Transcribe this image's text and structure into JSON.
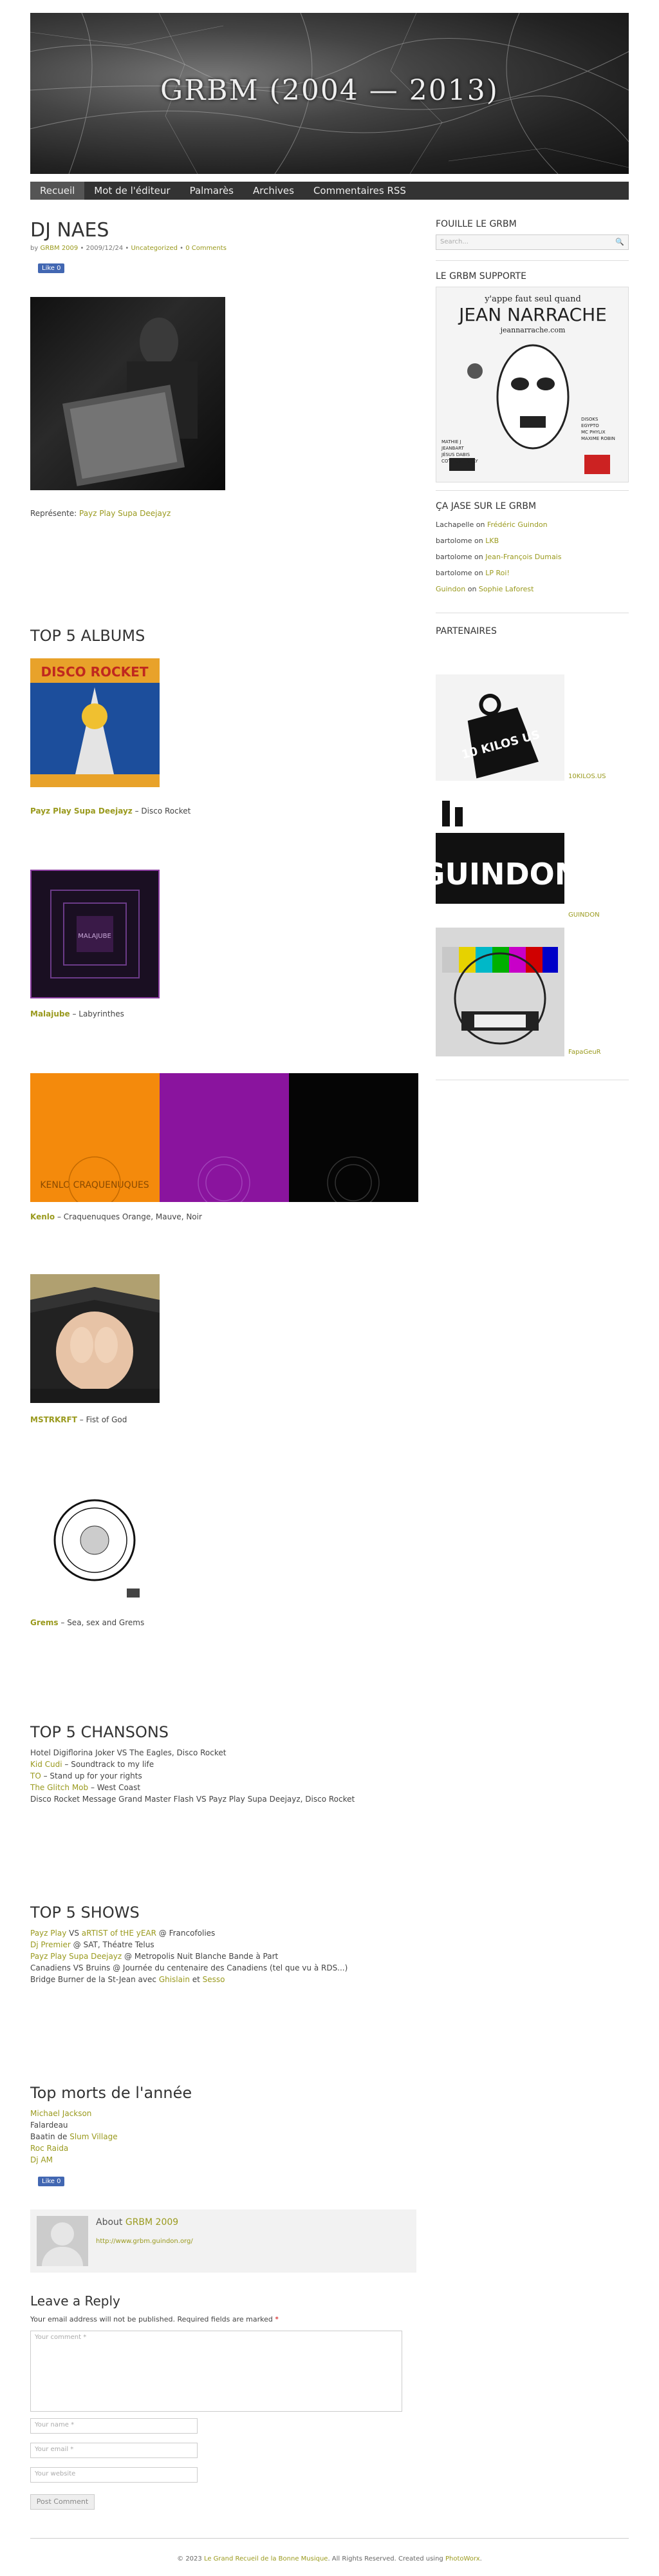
{
  "site": {
    "title": "GRBM (2004 — 2013)"
  },
  "nav": {
    "items": [
      "Recueil",
      "Mot de l'éditeur",
      "Palmarès",
      "Archives",
      "Commentaires RSS"
    ]
  },
  "post": {
    "title": "DJ NAES",
    "meta_by": "by",
    "meta_author": "GRBM 2009",
    "meta_date": " • 2009/12/24 • ",
    "meta_cat": "Uncategorized",
    "meta_sep": " • ",
    "meta_comments": "0 Comments",
    "like": "Like 0",
    "represent_label": "Représente: ",
    "represent_link": "Payz Play Supa Deejayz"
  },
  "albums": {
    "heading": "TOP 5 ALBUMS",
    "items": [
      {
        "artist": "Payz Play Supa Deejayz",
        "title": " – Disco Rocket"
      },
      {
        "artist": "Malajube",
        "title": " – Labyrinthes"
      },
      {
        "artist": "Kenlo",
        "title": " – Craquenuques Orange, Mauve, Noir"
      },
      {
        "artist": "MSTRKRFT",
        "title": " – Fist of God"
      },
      {
        "artist": "Grems",
        "title": " – Sea, sex and Grems"
      }
    ]
  },
  "songs": {
    "heading": "TOP 5 CHANSONS",
    "lines": [
      {
        "link": "",
        "text": "Hotel Digiflorina Joker VS The Eagles, Disco Rocket"
      },
      {
        "link": "Kid Cudi",
        "text": " – Soundtrack to my life"
      },
      {
        "link": "TO",
        "text": " – Stand up for your rights"
      },
      {
        "link": "The Glitch Mob",
        "text": " – West Coast"
      },
      {
        "link": "",
        "text": "Disco Rocket Message Grand Master Flash VS Payz Play Supa Deejayz, Disco Rocket"
      }
    ]
  },
  "shows": {
    "heading": "TOP 5 SHOWS",
    "lines": [
      {
        "a": "Payz Play",
        "b": " VS ",
        "c": "aRTIST of tHE yEAR",
        "d": " @ Francofolies"
      },
      {
        "a": "Dj Premier",
        "b": " @ SAT, Théatre Telus",
        "c": "",
        "d": ""
      },
      {
        "a": "Payz Play Supa Deejayz",
        "b": " @ Metropolis Nuit Blanche Bande à Part",
        "c": "",
        "d": ""
      },
      {
        "a": "",
        "b": "Canadiens VS Bruins @ Journée du centenaire des Canadiens (tel que vu à RDS...)",
        "c": "",
        "d": ""
      },
      {
        "a": "",
        "b": "Bridge Burner de la St-Jean avec ",
        "c": "Ghislain",
        "d": " et ",
        "e": "Sesso"
      }
    ]
  },
  "deaths": {
    "heading": "Top morts de l'année",
    "lines": [
      {
        "link": "Michael Jackson",
        "text": ""
      },
      {
        "link": "",
        "text": "Falardeau"
      },
      {
        "link": "Slum Village",
        "text": "Baatin de "
      },
      {
        "link": "Roc Raida",
        "text": ""
      },
      {
        "link": "Dj AM",
        "text": ""
      }
    ],
    "like": "Like 0"
  },
  "about": {
    "label": "About ",
    "name": "GRBM 2009",
    "url": "http://www.grbm.guindon.org/"
  },
  "reply": {
    "heading": "Leave a Reply",
    "note": "Your email address will not be published. Required fields are marked ",
    "star": "*",
    "comment_ph": "Your comment *",
    "name_ph": "Your name *",
    "email_ph": "Your email *",
    "website_ph": "Your website",
    "submit": "Post Comment"
  },
  "sidebar": {
    "search_h": "FOUILLE LE GRBM",
    "search_ph": "Search...",
    "supports_h": "LE GRBM SUPPORTE",
    "poster": {
      "top": "y'appe faut seul quand",
      "name": "JEAN NARRACHE",
      "url": "jeannarrache.com",
      "left": "MATHIE J\nJEANBART\nJÉSUS DABIS\nCOTT ONE & JAY",
      "right": "DISOKS\nEGYPTO\nMC PHYLIX\nMAXIME ROBIN"
    },
    "comments_h": "ÇA JASE SUR LE GRBM",
    "comments": [
      {
        "who": "Lachapelle",
        "on": " on ",
        "post": "Frédéric Guindon"
      },
      {
        "who": "bartolome",
        "on": " on ",
        "post": "LKB"
      },
      {
        "who": "bartolome",
        "on": " on ",
        "post": "Jean-François Dumais"
      },
      {
        "who": "bartolome",
        "on": " on ",
        "post": "LP Roi!"
      },
      {
        "who": "Guindon",
        "on": " on ",
        "post": "Sophie Laforest"
      }
    ],
    "partners_h": "PARTENAIRES",
    "partners": [
      "10KILOS.US",
      "GUINDON",
      "FapaGeuR"
    ],
    "partner_10_text": "10\nKILOS\nUS",
    "partner_g_text": "GUINDON"
  },
  "album_art": {
    "disco": "DISCO ROCKET",
    "mala": "MALAJUBE",
    "kenlo": "KENLO\nCRAQUENUQUES"
  },
  "footer": {
    "pre": "© 2023 ",
    "link1": "Le Grand Recueil de la Bonne Musique",
    "mid": ". All Rights Reserved. Created using ",
    "link2": "PhotoWorx",
    "post": "."
  }
}
